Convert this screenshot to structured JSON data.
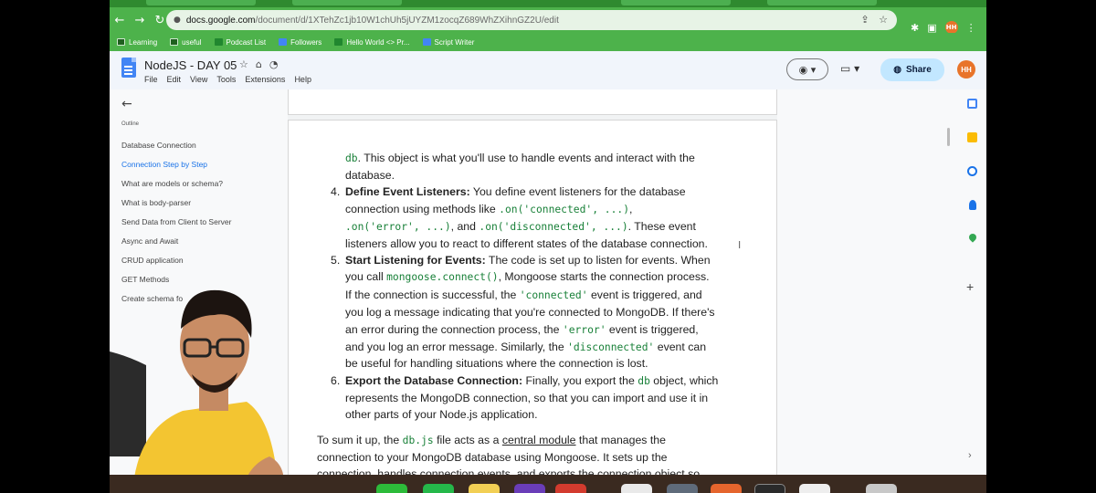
{
  "browser": {
    "url_host": "docs.google.com",
    "url_path": "/document/d/1XTehZc1jb10W1chUh5jUYZM1zocqZ689WhZXihnGZ2U/edit",
    "profile_initials": "HH",
    "bookmarks": [
      {
        "label": "Learning"
      },
      {
        "label": "useful"
      },
      {
        "label": "Podcast List"
      },
      {
        "label": "Followers"
      },
      {
        "label": "Hello World <> Pr..."
      },
      {
        "label": "Script Writer"
      }
    ]
  },
  "doc": {
    "title": "NodeJS - DAY 05",
    "menu": [
      "File",
      "Edit",
      "View",
      "Tools",
      "Extensions",
      "Help"
    ],
    "share_label": "Share",
    "user_initials": "HH"
  },
  "outline": {
    "label": "Outline",
    "items": [
      {
        "label": "Database Connection"
      },
      {
        "label": "Connection Step by Step"
      },
      {
        "label": "What are models or schema?"
      },
      {
        "label": "What is body-parser"
      },
      {
        "label": "Send Data from Client to Server"
      },
      {
        "label": "Async and Await"
      },
      {
        "label": "CRUD application"
      },
      {
        "label": "GET Methods"
      },
      {
        "label": "Create schema fo"
      }
    ]
  },
  "content": {
    "l1_code": "db",
    "l1_text": ". This object is what you'll use to handle events and interact with the",
    "l2": "database.",
    "i4_num": "4.",
    "i4_bold": "Define Event Listeners:",
    "i4_text": " You define event listeners for the database",
    "l4b_text": "connection using methods like ",
    "l4b_code1": ".on('connected', ...)",
    "l4b_sep": ",",
    "l4c_code1": ".on('error', ...)",
    "l4c_mid": ", and ",
    "l4c_code2": ".on('disconnected', ...)",
    "l4c_end": ". These event",
    "l4d": "listeners allow you to react to different states of the database connection.",
    "i5_num": "5.",
    "i5_bold": "Start Listening for Events:",
    "i5_text": " The code is set up to listen for events. When",
    "l5b_text": "you call ",
    "l5b_code": "mongoose.connect()",
    "l5b_end": ", Mongoose starts the connection process.",
    "l5c_text": "If the connection is successful, the ",
    "l5c_code": "'connected'",
    "l5c_end": " event is triggered, and",
    "l5d": "you log a message indicating that you're connected to MongoDB. If there's",
    "l5e_text": "an error during the connection process, the ",
    "l5e_code": "'error'",
    "l5e_end": " event is triggered,",
    "l5f_text": "and you log an error message. Similarly, the ",
    "l5f_code": "'disconnected'",
    "l5f_end": " event can",
    "l5g": "be useful for handling situations where the connection is lost.",
    "i6_num": "6.",
    "i6_bold": "Export the Database Connection:",
    "i6_text": " Finally, you export the ",
    "i6_code": "db",
    "i6_end": " object, which",
    "l6b": "represents the MongoDB connection, so that you can import and use it in",
    "l6c": "other parts of your Node.js application.",
    "s1_text": "To sum it up, the ",
    "s1_code": "db.js",
    "s1_mid": " file acts as a ",
    "s1_u": "central module",
    "s1_end": " that manages the",
    "s2": "connection to your MongoDB database using Mongoose. It sets up the",
    "s3": "connection, handles connection events, and exports the connection object so"
  },
  "colors": {
    "browser_green": "#4db24b",
    "code_green": "#188038",
    "accent_blue": "#1a73e8",
    "share_bg": "#c2e7ff"
  }
}
